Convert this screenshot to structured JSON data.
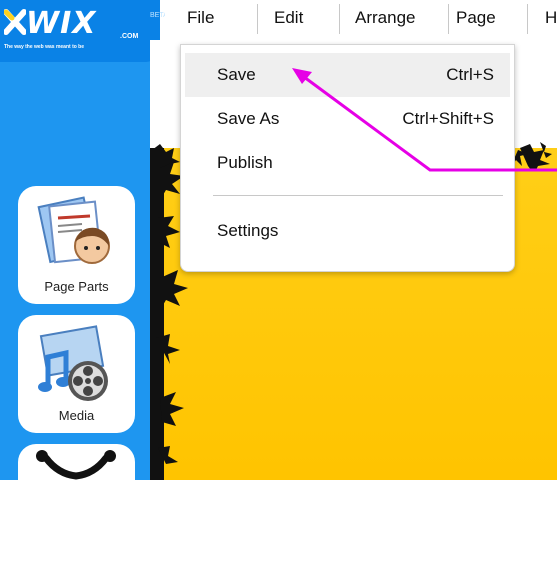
{
  "logo": {
    "text": "WIX",
    "com": ".COM",
    "beta": "BETA",
    "tagline": "The way the web was meant to be"
  },
  "menubar": {
    "items": [
      "File",
      "Edit",
      "Arrange",
      "Page",
      "H"
    ]
  },
  "file_menu": {
    "items": [
      {
        "label": "Save",
        "shortcut": "Ctrl+S"
      },
      {
        "label": "Save As",
        "shortcut": "Ctrl+Shift+S"
      },
      {
        "label": "Publish",
        "shortcut": ""
      },
      {
        "label": "Settings",
        "shortcut": ""
      }
    ]
  },
  "sidebar": {
    "buttons": [
      {
        "label": "Page Parts"
      },
      {
        "label": "Media"
      },
      {
        "label": ""
      }
    ]
  },
  "colors": {
    "sidebar": "#1e96f0",
    "canvas": "#ffc400",
    "annotation_arrow": "#e600e6"
  }
}
